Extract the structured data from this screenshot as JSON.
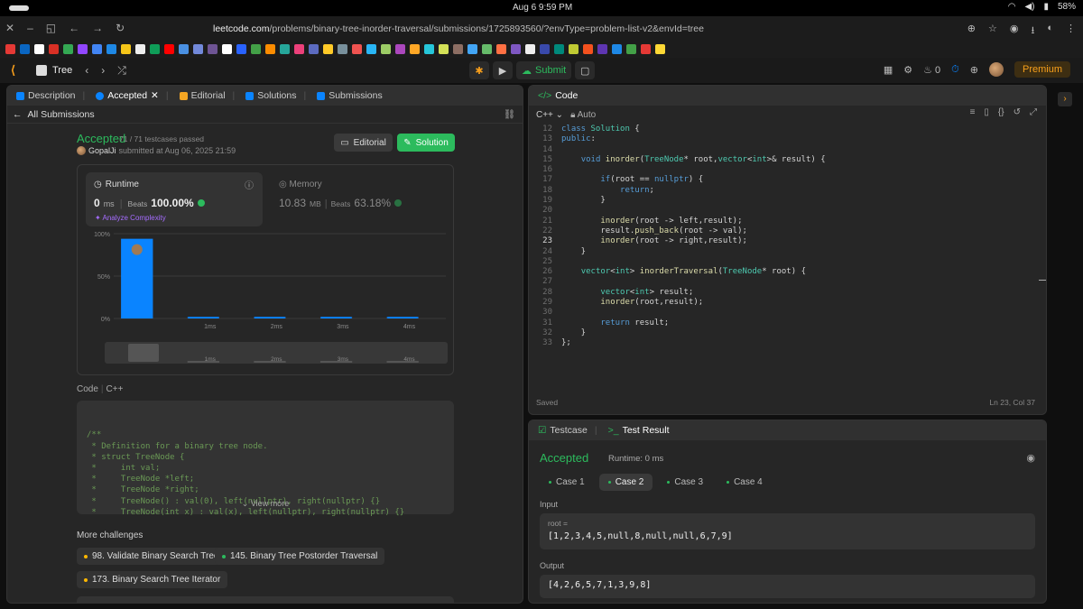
{
  "os": {
    "clock": "Aug 6   9:59 PM",
    "battery": "58%"
  },
  "browser": {
    "url_host": "leetcode.com",
    "url_path": "/problems/binary-tree-inorder-traversal/submissions/1725893560/?envType=problem-list-v2&envId=tree"
  },
  "lc_header": {
    "problem_list": "Tree",
    "submit_label": "Submit",
    "streak": "0",
    "premium_label": "Premium"
  },
  "left_tabs": [
    {
      "label": "Description"
    },
    {
      "label": "Accepted"
    },
    {
      "label": "Editorial"
    },
    {
      "label": "Solutions"
    },
    {
      "label": "Submissions"
    }
  ],
  "submission": {
    "back_label": "All Submissions",
    "status": "Accepted",
    "testcases": "71 / 71  testcases passed",
    "user": "GopalJi",
    "submitted_text": "submitted at Aug 06, 2025 21:59",
    "editorial_btn": "Editorial",
    "solution_btn": "Solution",
    "runtime_label": "Runtime",
    "runtime_value": "0",
    "runtime_unit": "ms",
    "beats_label": "Beats",
    "runtime_beats": "100.00%",
    "analyze_label": "Analyze Complexity",
    "memory_label": "Memory",
    "memory_value": "10.83",
    "memory_unit": "MB",
    "memory_beats": "63.18%",
    "code_label": "Code",
    "code_lang": "C++",
    "code_snippet": "/**\n * Definition for a binary tree node.\n * struct TreeNode {\n *     int val;\n *     TreeNode *left;\n *     TreeNode *right;\n *     TreeNode() : val(0), left(nullptr), right(nullptr) {}\n *     TreeNode(int x) : val(x), left(nullptr), right(nullptr) {}",
    "view_more": "View more",
    "more_challenges_label": "More challenges",
    "challenges": [
      {
        "label": "98. Validate Binary Search Tree",
        "color": "#ffb800"
      },
      {
        "label": "145. Binary Tree Postorder Traversal",
        "color": "#2cbb5d"
      },
      {
        "label": "173. Binary Search Tree Iterator",
        "color": "#ffb800"
      }
    ]
  },
  "chart_data": {
    "type": "bar",
    "categories": [
      "0ms",
      "1ms",
      "2ms",
      "3ms",
      "4ms"
    ],
    "x_tick_labels": [
      "",
      "1ms",
      "2ms",
      "3ms",
      "4ms"
    ],
    "values": [
      94,
      2,
      2,
      2,
      2
    ],
    "y_tick_labels": [
      "100%",
      "50%",
      "0%"
    ],
    "ylim": [
      0,
      100
    ],
    "highlighted_category": "0ms",
    "bar_color": "#0a84ff",
    "grid": true
  },
  "editor": {
    "tab_label": "Code",
    "lang": "C++",
    "mode": "Auto",
    "status": "Saved",
    "cursor": "Ln 23, Col 37",
    "start_line": 12,
    "current_line": 23,
    "lines": [
      "class Solution {",
      "public:",
      "",
      "    void inorder(TreeNode* root,vector<int>& result) {",
      "",
      "        if(root == nullptr) {",
      "            return;",
      "        }",
      "",
      "        inorder(root -> left,result);",
      "        result.push_back(root -> val);",
      "        inorder(root -> right,result);",
      "    }",
      "",
      "    vector<int> inorderTraversal(TreeNode* root) {",
      "",
      "        vector<int> result;",
      "        inorder(root,result);",
      "",
      "        return result;",
      "    }",
      "};"
    ]
  },
  "result": {
    "tab_testcase": "Testcase",
    "tab_result": "Test Result",
    "status": "Accepted",
    "runtime": "Runtime: 0 ms",
    "cases": [
      "Case 1",
      "Case 2",
      "Case 3",
      "Case 4"
    ],
    "active_case": 1,
    "input_label": "Input",
    "input_var": "root =",
    "input_value": "[1,2,3,4,5,null,8,null,null,6,7,9]",
    "output_label": "Output",
    "output_value": "[4,2,6,5,7,1,3,9,8]"
  }
}
